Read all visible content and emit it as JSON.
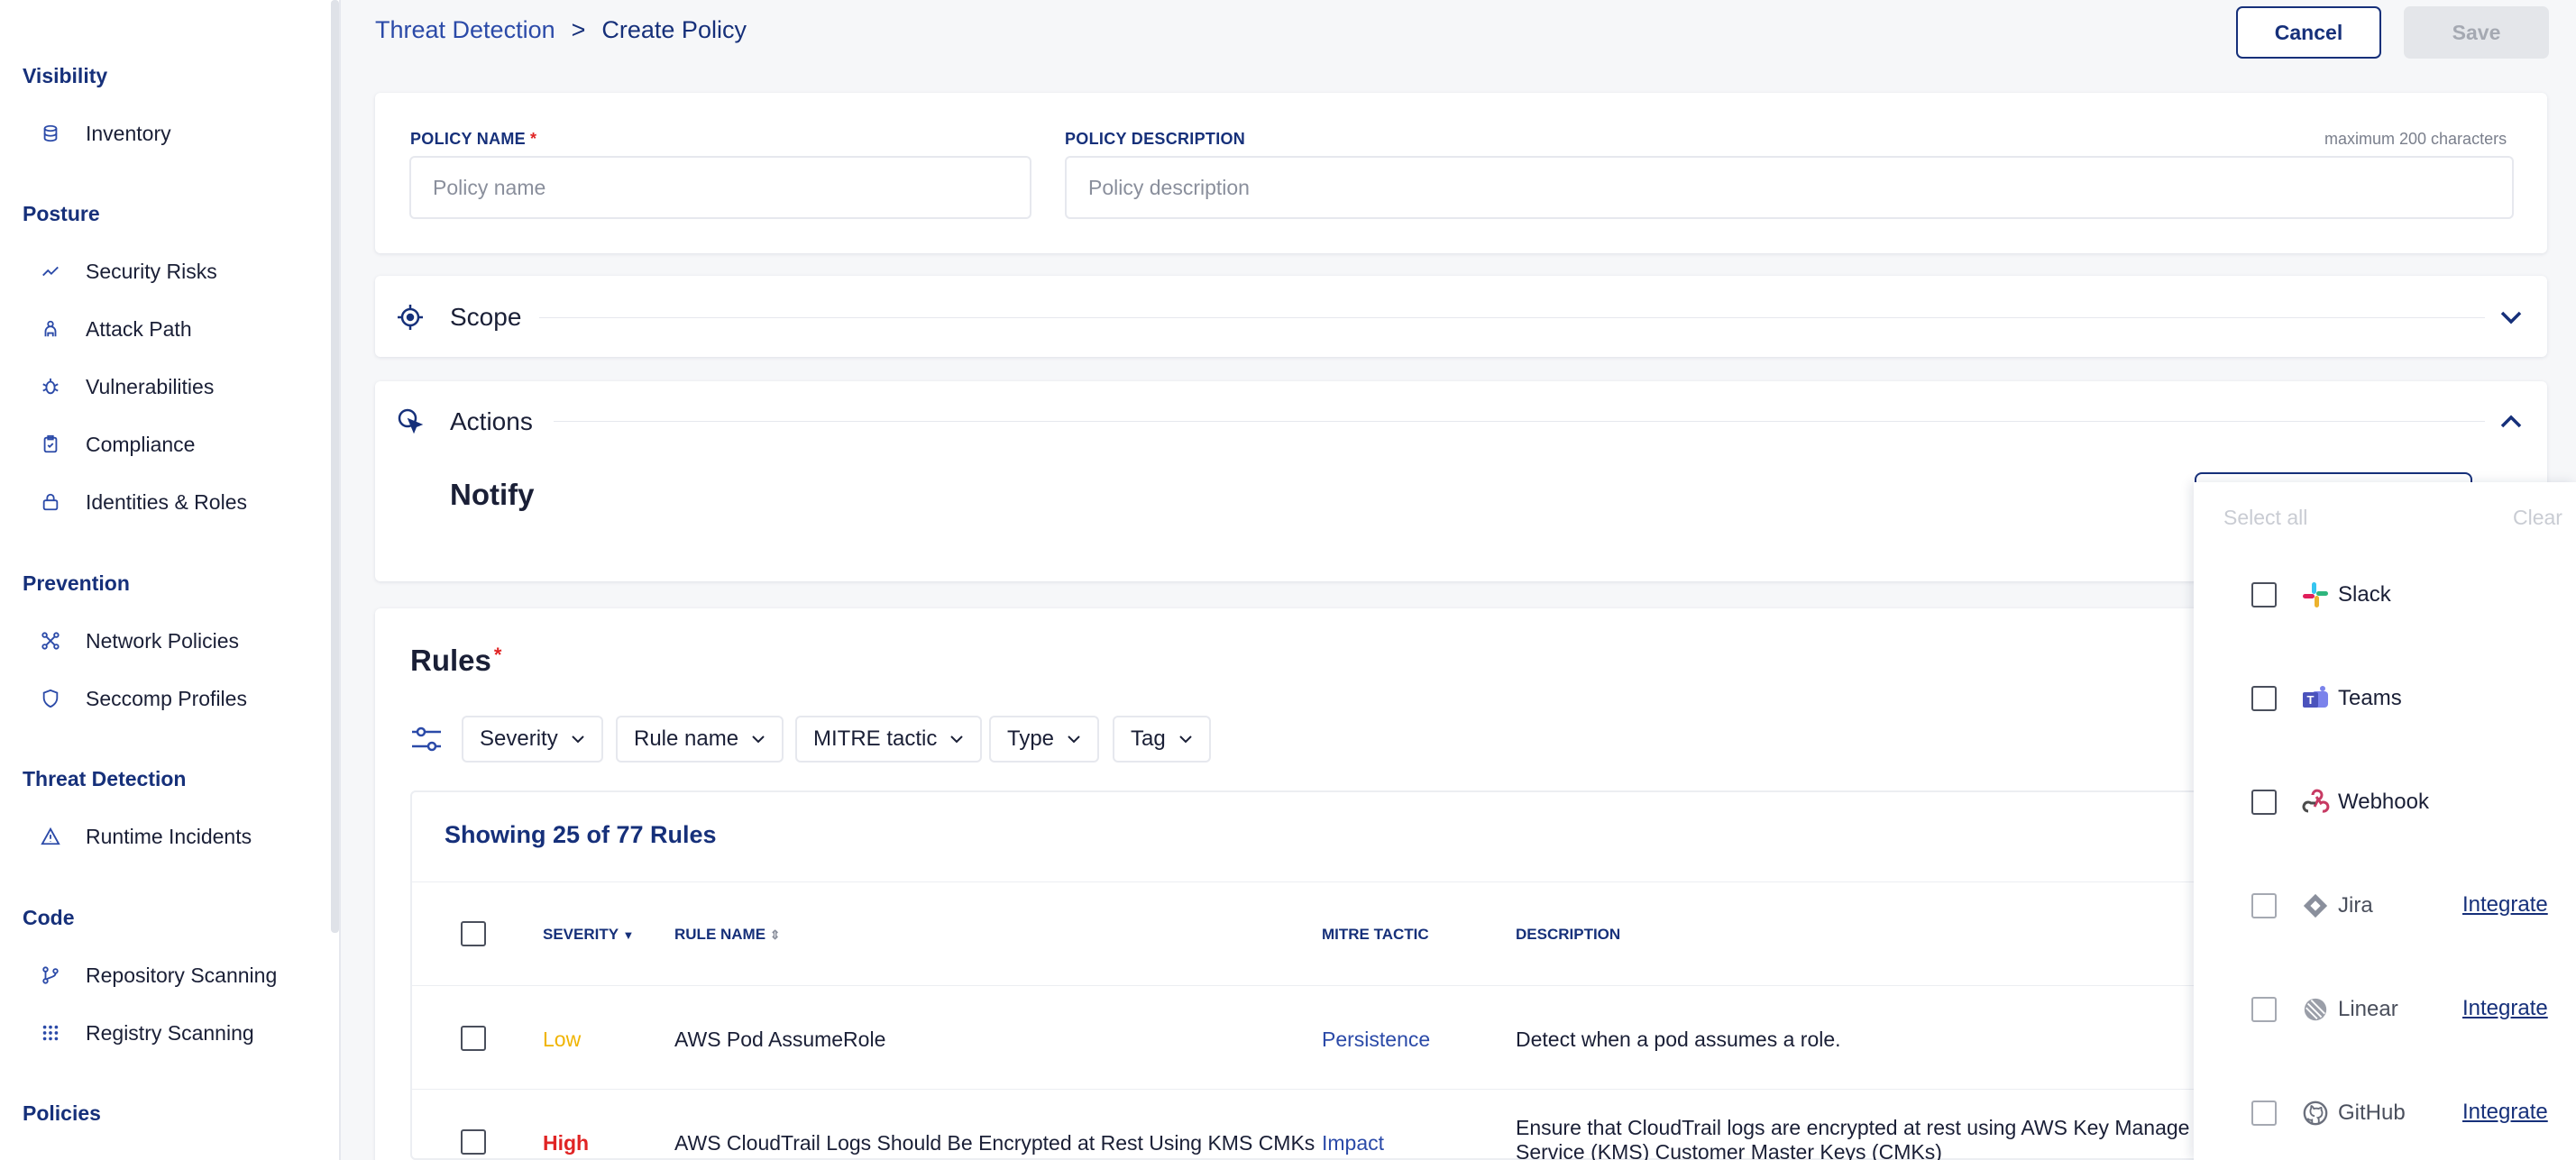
{
  "sidebar": {
    "sections": [
      {
        "title": "Visibility",
        "items": [
          {
            "label": "Inventory",
            "icon": "database-icon"
          }
        ]
      },
      {
        "title": "Posture",
        "items": [
          {
            "label": "Security Risks",
            "icon": "trend-line-icon"
          },
          {
            "label": "Attack Path",
            "icon": "attack-path-icon"
          },
          {
            "label": "Vulnerabilities",
            "icon": "bug-icon"
          },
          {
            "label": "Compliance",
            "icon": "checklist-icon"
          },
          {
            "label": "Identities & Roles",
            "icon": "lock-icon"
          }
        ]
      },
      {
        "title": "Prevention",
        "items": [
          {
            "label": "Network Policies",
            "icon": "network-icon"
          },
          {
            "label": "Seccomp Profiles",
            "icon": "shield-icon"
          }
        ]
      },
      {
        "title": "Threat Detection",
        "items": [
          {
            "label": "Runtime Incidents",
            "icon": "warning-icon"
          }
        ]
      },
      {
        "title": "Code",
        "items": [
          {
            "label": "Repository Scanning",
            "icon": "git-branch-icon"
          },
          {
            "label": "Registry Scanning",
            "icon": "grid-dots-icon"
          }
        ]
      },
      {
        "title": "Policies",
        "items": []
      }
    ]
  },
  "header": {
    "breadcrumb_parent": "Threat Detection",
    "breadcrumb_separator": ">",
    "breadcrumb_current": "Create Policy",
    "cancel_label": "Cancel",
    "save_label": "Save"
  },
  "policy_form": {
    "name_label": "POLICY NAME",
    "name_required": "*",
    "name_placeholder": "Policy name",
    "name_value": "",
    "description_label": "POLICY DESCRIPTION",
    "description_hint": "maximum 200 characters",
    "description_placeholder": "Policy description",
    "description_value": ""
  },
  "scope": {
    "title": "Scope"
  },
  "actions": {
    "title": "Actions",
    "notify_title": "Notify"
  },
  "rules": {
    "title": "Rules",
    "required": "*",
    "filters": [
      "Severity",
      "Rule name",
      "MITRE tactic",
      "Type",
      "Tag"
    ],
    "showing_text": "Showing 25 of 77 Rules",
    "columns": {
      "severity": "SEVERITY",
      "rule_name": "RULE NAME",
      "mitre_tactic": "MITRE TACTIC",
      "description": "DESCRIPTION"
    },
    "rows": [
      {
        "severity": "Low",
        "severity_color": "#f0b400",
        "rule_name": "AWS Pod AssumeRole",
        "mitre_tactic": "Persistence",
        "description": "Detect when a pod assumes a role."
      },
      {
        "severity": "High",
        "severity_color": "#e02424",
        "rule_name": "AWS CloudTrail Logs Should Be Encrypted at Rest Using KMS CMKs",
        "mitre_tactic": "Impact",
        "description": "Ensure that CloudTrail logs are encrypted at rest using AWS Key Manage",
        "description_line2": "Service (KMS) Customer Master Keys (CMKs)"
      }
    ]
  },
  "notify_dropdown": {
    "select_all_label": "Select all",
    "clear_label": "Clear",
    "options": [
      {
        "label": "Slack",
        "icon": "slack-icon",
        "integrate": ""
      },
      {
        "label": "Teams",
        "icon": "teams-icon",
        "integrate": ""
      },
      {
        "label": "Webhook",
        "icon": "webhook-icon",
        "integrate": ""
      },
      {
        "label": "Jira",
        "icon": "jira-icon",
        "integrate": "Integrate"
      },
      {
        "label": "Linear",
        "icon": "linear-icon",
        "integrate": "Integrate"
      },
      {
        "label": "GitHub",
        "icon": "github-icon",
        "integrate": "Integrate"
      }
    ]
  }
}
